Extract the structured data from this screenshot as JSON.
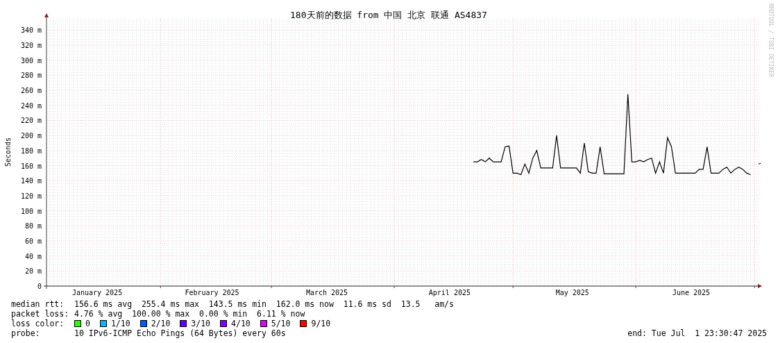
{
  "title": "180天前的数据 from 中国 北京 联通 AS4837",
  "watermark": "RRDTOOL / TOBI OETIKER",
  "chart_data": {
    "type": "line",
    "ylabel": "Seconds",
    "categories": [
      null,
      null,
      null,
      null,
      null,
      null,
      null,
      null,
      null,
      null,
      null,
      null,
      null,
      "January 2025",
      null,
      null,
      null,
      null,
      null,
      null,
      null,
      null,
      null,
      null,
      null,
      null,
      null,
      null,
      null,
      null,
      null,
      null,
      null,
      null,
      null,
      null,
      null,
      null,
      null,
      null,
      null,
      null,
      "February 2025",
      null,
      null,
      null,
      null,
      null,
      null,
      null,
      null,
      null,
      null,
      null,
      null,
      null,
      null,
      null,
      null,
      null,
      null,
      null,
      null,
      null,
      null,
      null,
      null,
      null,
      null,
      null,
      null,
      "March 2025",
      null,
      null,
      null,
      null,
      null,
      null,
      null,
      null,
      null,
      null,
      null,
      null,
      null,
      null,
      null,
      null,
      null,
      null,
      null,
      null,
      null,
      null,
      null,
      null,
      null,
      null,
      null,
      null,
      null,
      null,
      "April 2025",
      null,
      null,
      null,
      null,
      null,
      null,
      null,
      null,
      null,
      null,
      null,
      null,
      null,
      null,
      null,
      null,
      null,
      null,
      null,
      null,
      null,
      null,
      null,
      null,
      null,
      null,
      null,
      null,
      null,
      null,
      "May 2025",
      null,
      null,
      null,
      null,
      null,
      null,
      null,
      null,
      null,
      null,
      null,
      null,
      null,
      null,
      null,
      null,
      null,
      null,
      null,
      null,
      null,
      null,
      null,
      null,
      null,
      null,
      null,
      null,
      null,
      "June 2025",
      null,
      null,
      null,
      null,
      null,
      null,
      null,
      null,
      null,
      null,
      null,
      null,
      null,
      null,
      null,
      null,
      null
    ],
    "series": [
      {
        "color": "#000000",
        "values": [
          null,
          null,
          null,
          null,
          null,
          null,
          null,
          null,
          null,
          null,
          null,
          null,
          null,
          null,
          null,
          null,
          null,
          null,
          null,
          null,
          null,
          null,
          null,
          null,
          null,
          null,
          null,
          null,
          null,
          null,
          null,
          null,
          null,
          null,
          null,
          null,
          null,
          null,
          null,
          null,
          null,
          null,
          null,
          null,
          null,
          null,
          null,
          null,
          null,
          null,
          null,
          null,
          null,
          null,
          null,
          null,
          null,
          null,
          null,
          null,
          null,
          null,
          null,
          null,
          null,
          null,
          null,
          null,
          null,
          null,
          null,
          null,
          null,
          null,
          null,
          null,
          null,
          null,
          null,
          null,
          null,
          null,
          null,
          null,
          null,
          null,
          null,
          null,
          null,
          null,
          null,
          null,
          null,
          null,
          null,
          null,
          null,
          null,
          null,
          null,
          null,
          null,
          null,
          null,
          null,
          null,
          null,
          null,
          165,
          165,
          168,
          165,
          170,
          165,
          165,
          165,
          185,
          186,
          150,
          150,
          148,
          162,
          150,
          170,
          180,
          157,
          157,
          157,
          157,
          200,
          157,
          157,
          157,
          157,
          157,
          150,
          190,
          152,
          150,
          150,
          185,
          149,
          149,
          149,
          149,
          149,
          149,
          255,
          165,
          165,
          167,
          165,
          168,
          170,
          150,
          165,
          150,
          197,
          185,
          150,
          150,
          150,
          150,
          150,
          150,
          155,
          155,
          185,
          150,
          150,
          150,
          155,
          158,
          150,
          155,
          158,
          155,
          150,
          148,
          null,
          162
        ]
      }
    ],
    "ylim": [
      0,
      356
    ],
    "grid": true,
    "yticks": [
      {
        "value": 0,
        "label": "0"
      },
      {
        "value": 20,
        "label": "20 m"
      },
      {
        "value": 40,
        "label": "40 m"
      },
      {
        "value": 60,
        "label": "60 m"
      },
      {
        "value": 80,
        "label": "80 m"
      },
      {
        "value": 100,
        "label": "100 m"
      },
      {
        "value": 120,
        "label": "120 m"
      },
      {
        "value": 140,
        "label": "140 m"
      },
      {
        "value": 160,
        "label": "160 m"
      },
      {
        "value": 180,
        "label": "180 m"
      },
      {
        "value": 200,
        "label": "200 m"
      },
      {
        "value": 220,
        "label": "220 m"
      },
      {
        "value": 240,
        "label": "240 m"
      },
      {
        "value": 260,
        "label": "260 m"
      },
      {
        "value": 280,
        "label": "280 m"
      },
      {
        "value": 300,
        "label": "300 m"
      },
      {
        "value": 320,
        "label": "320 m"
      },
      {
        "value": 340,
        "label": "340 m"
      }
    ]
  },
  "legend": {
    "stats": [
      {
        "label": "median rtt:",
        "text": "156.6 ms avg  255.4 ms max  143.5 ms min  162.0 ms now  11.6 ms sd  13.5   am/s"
      },
      {
        "label": "packet loss:",
        "text": "4.76 % avg  100.00 % max  0.00 % min  6.11 % now"
      }
    ],
    "loss_color": {
      "label": "loss color:",
      "items": [
        {
          "label": "0",
          "color": "#26ff00"
        },
        {
          "label": "1/10",
          "color": "#00b8ff"
        },
        {
          "label": "2/10",
          "color": "#0059ff"
        },
        {
          "label": "3/10",
          "color": "#5e00ff"
        },
        {
          "label": "4/10",
          "color": "#7e00ff"
        },
        {
          "label": "5/10",
          "color": "#dd00ff"
        },
        {
          "label": "9/10",
          "color": "#ff0000"
        }
      ]
    },
    "probe": {
      "label": "probe:",
      "text": "10 IPv6-ICMP Echo Pings (64 Bytes) every 60s"
    },
    "end": "end: Tue Jul  1 23:30:47 2025"
  }
}
